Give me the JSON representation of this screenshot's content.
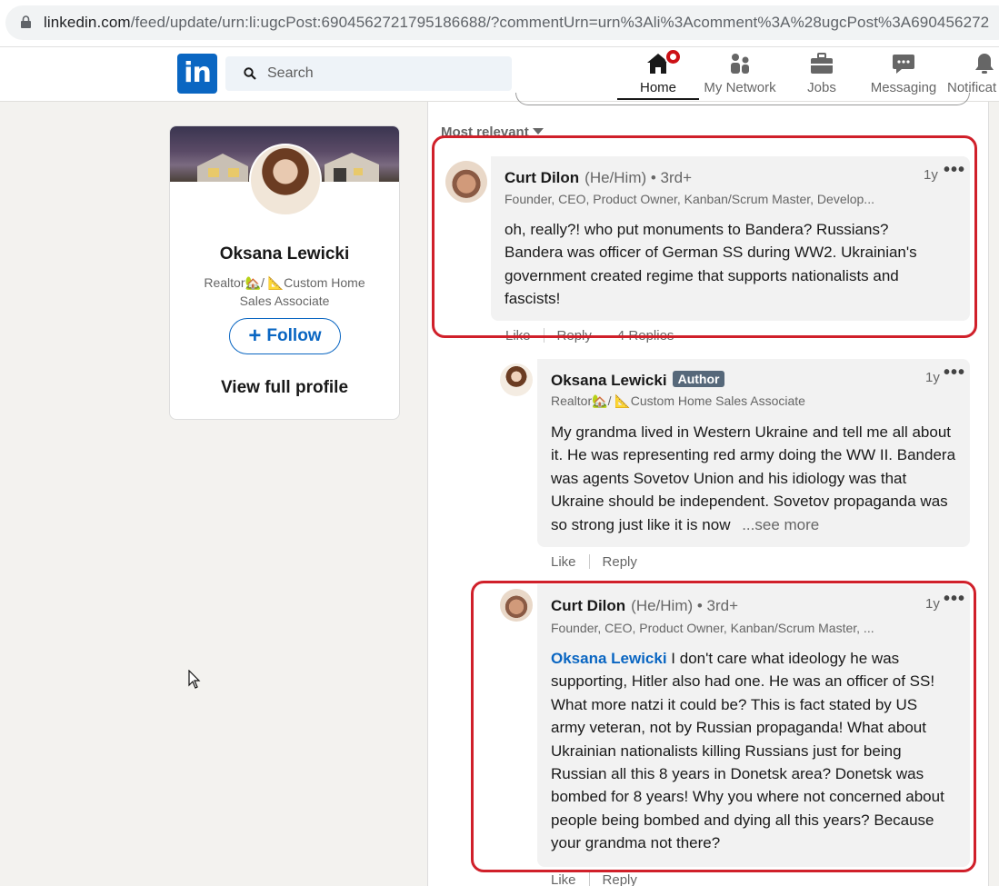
{
  "browser": {
    "url_host": "linkedin.com",
    "url_path": "/feed/update/urn:li:ugcPost:6904562721795186688/?commentUrn=urn%3Ali%3Acomment%3A%28ugcPost%3A690456272"
  },
  "nav": {
    "search_placeholder": "Search",
    "items": [
      {
        "label": "Home",
        "icon": "home-icon",
        "active": true
      },
      {
        "label": "My Network",
        "icon": "network-icon"
      },
      {
        "label": "Jobs",
        "icon": "briefcase-icon"
      },
      {
        "label": "Messaging",
        "icon": "messaging-icon"
      },
      {
        "label": "Notificat",
        "icon": "bell-icon"
      }
    ]
  },
  "profile": {
    "name": "Oksana Lewicki",
    "headline": "Realtor🏡/ 📐Custom Home Sales Associate",
    "follow_label": "Follow",
    "view_profile_label": "View full profile"
  },
  "feed": {
    "sort_label": "Most relevant",
    "comments": [
      {
        "author": "Curt Dilon",
        "pronouns": "(He/Him)",
        "degree": " • 3rd+",
        "headline": "Founder, CEO, Product Owner, Kanban/Scrum Master, Develop...",
        "time": "1y",
        "text": "oh, really?! who put monuments to Bandera? Russians? Bandera was officer of German SS during WW2. Ukrainian's government created regime that supports nationalists and fascists!",
        "like": "Like",
        "reply": "Reply",
        "replies": "4 Replies"
      },
      {
        "author": "Oksana Lewicki",
        "badge": "Author",
        "headline": "Realtor🏡/ 📐Custom Home Sales Associate",
        "time": "1y",
        "text": "My grandma lived in Western Ukraine and tell me all about it. He was representing red army doing the WW II. Bandera was agents Sovetov Union and his idiology was that Ukraine should be independent. Sovetov propaganda was so strong just like it is now",
        "see_more": "...see more",
        "like": "Like",
        "reply": "Reply"
      },
      {
        "author": "Curt Dilon",
        "pronouns": "(He/Him)",
        "degree": " • 3rd+",
        "headline": "Founder, CEO, Product Owner, Kanban/Scrum Master, ...",
        "time": "1y",
        "mention": "Oksana Lewicki",
        "text": " I don't care what ideology he was supporting, Hitler also had one. He was an officer of SS! What more natzi it could be? This is fact stated by US army veteran, not by Russian propaganda! What about Ukrainian nationalists killing Russians just for being Russian all this 8 years in Donetsk area? Donetsk was bombed for 8 years! Why you where not concerned about people being bombed and dying all this years? Because your grandma not there?",
        "like": "Like",
        "reply": "Reply"
      }
    ]
  },
  "colors": {
    "linkedin_blue": "#0a66c2",
    "highlight_red": "#d0202a",
    "badge_red": "#cc1016"
  }
}
